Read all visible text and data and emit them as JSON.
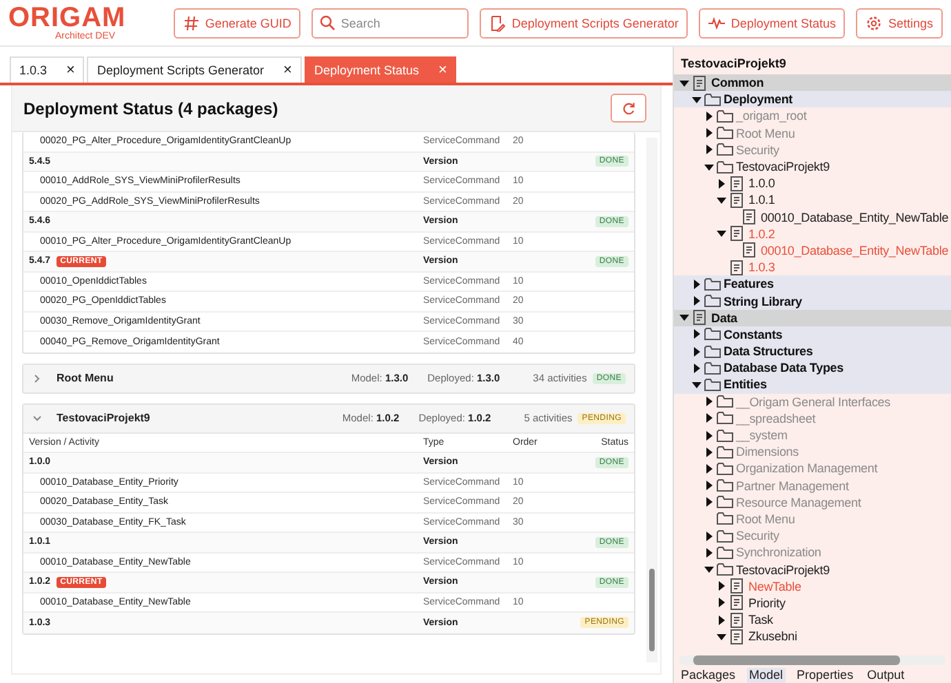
{
  "header": {
    "logo": {
      "title": "ORIGAM",
      "subtitle": "Architect DEV"
    },
    "actions": [
      {
        "kind": "button",
        "label": "Generate GUID"
      },
      {
        "kind": "search",
        "placeholder": "Search"
      },
      {
        "kind": "button",
        "label": "Deployment Scripts Generator"
      },
      {
        "kind": "button",
        "label": "Deployment Status"
      },
      {
        "kind": "button",
        "label": "Settings"
      }
    ]
  },
  "tabs": [
    {
      "label": "1.0.3",
      "close": "×",
      "selected": false
    },
    {
      "label": "Deployment Scripts Generator",
      "close": "×",
      "selected": false
    },
    {
      "label": "Deployment Status",
      "close": "×",
      "selected": true
    }
  ],
  "panel": {
    "title": "Deployment Status (4 packages)",
    "packages": [
      {
        "kind": "partial",
        "rows": [
          {
            "kind": "activity",
            "name": "00020_PG_Alter_Procedure_OrigamIdentityGrantCleanUp",
            "type": "ServiceCommand",
            "order": "20"
          },
          {
            "kind": "version",
            "name": "5.4.5",
            "type": "Version",
            "status": {
              "text": "DONE",
              "kind": "done"
            }
          },
          {
            "kind": "activity",
            "name": "00010_AddRole_SYS_ViewMiniProfilerResults",
            "type": "ServiceCommand",
            "order": "10"
          },
          {
            "kind": "activity",
            "name": "00020_PG_AddRole_SYS_ViewMiniProfilerResults",
            "type": "ServiceCommand",
            "order": "20"
          },
          {
            "kind": "version",
            "name": "5.4.6",
            "type": "Version",
            "status": {
              "text": "DONE",
              "kind": "done"
            }
          },
          {
            "kind": "activity",
            "name": "00010_PG_Alter_Procedure_OrigamIdentityGrantCleanUp",
            "type": "ServiceCommand",
            "order": "10"
          },
          {
            "kind": "version",
            "name": "5.4.7",
            "tag": "CURRENT",
            "type": "Version",
            "status": {
              "text": "DONE",
              "kind": "done"
            }
          },
          {
            "kind": "activity",
            "name": "00010_OpenIddictTables",
            "type": "ServiceCommand",
            "order": "10"
          },
          {
            "kind": "activity",
            "name": "00020_PG_OpenIddictTables",
            "type": "ServiceCommand",
            "order": "20"
          },
          {
            "kind": "activity",
            "name": "00030_Remove_OrigamIdentityGrant",
            "type": "ServiceCommand",
            "order": "30"
          },
          {
            "kind": "activity",
            "name": "00040_PG_Remove_OrigamIdentityGrant",
            "type": "ServiceCommand",
            "order": "40"
          }
        ]
      },
      {
        "kind": "package",
        "name": "Root Menu",
        "expanded": false,
        "model": "Model: **1.3.0**",
        "deployed": "Deployed: **1.3.0**",
        "activities": "34 activities",
        "status": {
          "text": "DONE",
          "kind": "done"
        }
      },
      {
        "kind": "package",
        "name": "TestovaciProjekt9",
        "expanded": true,
        "model": "Model: **1.0.2**",
        "deployed": "Deployed: **1.0.2**",
        "activities": "5 activities",
        "status": {
          "text": "PENDING",
          "kind": "pending"
        },
        "columns": [
          "Version / Activity",
          "Type",
          "Order",
          "Status"
        ],
        "rows": [
          {
            "kind": "version",
            "name": "1.0.0",
            "type": "Version",
            "status": {
              "text": "DONE",
              "kind": "done"
            }
          },
          {
            "kind": "activity",
            "name": "00010_Database_Entity_Priority",
            "type": "ServiceCommand",
            "order": "10"
          },
          {
            "kind": "activity",
            "name": "00020_Database_Entity_Task",
            "type": "ServiceCommand",
            "order": "20"
          },
          {
            "kind": "activity",
            "name": "00030_Database_Entity_FK_Task",
            "type": "ServiceCommand",
            "order": "30"
          },
          {
            "kind": "version",
            "name": "1.0.1",
            "type": "Version",
            "status": {
              "text": "DONE",
              "kind": "done"
            }
          },
          {
            "kind": "activity",
            "name": "00010_Database_Entity_NewTable",
            "type": "ServiceCommand",
            "order": "10"
          },
          {
            "kind": "version",
            "name": "1.0.2",
            "tag": "CURRENT",
            "type": "Version",
            "status": {
              "text": "DONE",
              "kind": "done"
            }
          },
          {
            "kind": "activity",
            "name": "00010_Database_Entity_NewTable",
            "type": "ServiceCommand",
            "order": "10"
          },
          {
            "kind": "version",
            "name": "1.0.3",
            "type": "Version",
            "status": {
              "text": "PENDING",
              "kind": "pending"
            }
          }
        ]
      }
    ]
  },
  "sidebar": {
    "title": "TestovaciProjekt9",
    "tree": [
      {
        "label": "Common",
        "kind": "document",
        "bold": true,
        "greyed": false,
        "modified": false,
        "expanded": true,
        "children": [
          {
            "label": "Deployment",
            "kind": "folder",
            "bold": true,
            "greyed": false,
            "modified": false,
            "expanded": true,
            "children": [
              {
                "label": "_origam_root",
                "kind": "folder",
                "bold": false,
                "greyed": true,
                "modified": false,
                "expanded": false
              },
              {
                "label": "Root Menu",
                "kind": "folder",
                "bold": false,
                "greyed": true,
                "modified": false,
                "expanded": false
              },
              {
                "label": "Security",
                "kind": "folder",
                "bold": false,
                "greyed": true,
                "modified": false,
                "expanded": false
              },
              {
                "label": "TestovaciProjekt9",
                "kind": "folder",
                "bold": false,
                "greyed": false,
                "modified": false,
                "expanded": true,
                "children": [
                  {
                    "label": "1.0.0",
                    "kind": "document",
                    "bold": false,
                    "greyed": false,
                    "modified": false,
                    "expanded": false
                  },
                  {
                    "label": "1.0.1",
                    "kind": "document",
                    "bold": false,
                    "greyed": false,
                    "modified": false,
                    "expanded": true,
                    "children": [
                      {
                        "label": "00010_Database_Entity_NewTable",
                        "kind": "document",
                        "bold": false,
                        "greyed": false,
                        "modified": false
                      }
                    ]
                  },
                  {
                    "label": "1.0.2",
                    "kind": "document",
                    "bold": false,
                    "greyed": false,
                    "modified": true,
                    "expanded": true,
                    "children": [
                      {
                        "label": "00010_Database_Entity_NewTable",
                        "kind": "document",
                        "bold": false,
                        "greyed": false,
                        "modified": true
                      }
                    ]
                  },
                  {
                    "label": "1.0.3",
                    "kind": "document",
                    "bold": false,
                    "greyed": false,
                    "modified": true
                  }
                ]
              }
            ]
          },
          {
            "label": "Features",
            "kind": "folder",
            "bold": true,
            "greyed": false,
            "modified": false,
            "expanded": false
          },
          {
            "label": "String Library",
            "kind": "folder",
            "bold": true,
            "greyed": false,
            "modified": false,
            "expanded": false
          }
        ]
      },
      {
        "label": "Data",
        "kind": "document",
        "bold": true,
        "greyed": false,
        "modified": false,
        "expanded": true,
        "children": [
          {
            "label": "Constants",
            "kind": "folder",
            "bold": true,
            "greyed": false,
            "modified": false,
            "expanded": false
          },
          {
            "label": "Data Structures",
            "kind": "folder",
            "bold": true,
            "greyed": false,
            "modified": false,
            "expanded": false
          },
          {
            "label": "Database Data Types",
            "kind": "folder",
            "bold": true,
            "greyed": false,
            "modified": false,
            "expanded": false
          },
          {
            "label": "Entities",
            "kind": "folder",
            "bold": true,
            "greyed": false,
            "modified": false,
            "expanded": true,
            "children": [
              {
                "label": "__Origam General Interfaces",
                "kind": "folder",
                "bold": false,
                "greyed": true,
                "modified": false,
                "expanded": false
              },
              {
                "label": "__spreadsheet",
                "kind": "folder",
                "bold": false,
                "greyed": true,
                "modified": false,
                "expanded": false
              },
              {
                "label": "__system",
                "kind": "folder",
                "bold": false,
                "greyed": true,
                "modified": false,
                "expanded": false
              },
              {
                "label": "Dimensions",
                "kind": "folder",
                "bold": false,
                "greyed": true,
                "modified": false,
                "expanded": false
              },
              {
                "label": "Organization Management",
                "kind": "folder",
                "bold": false,
                "greyed": true,
                "modified": false,
                "expanded": false
              },
              {
                "label": "Partner Management",
                "kind": "folder",
                "bold": false,
                "greyed": true,
                "modified": false,
                "expanded": false
              },
              {
                "label": "Resource Management",
                "kind": "folder",
                "bold": false,
                "greyed": true,
                "modified": false,
                "expanded": false
              },
              {
                "label": "Root Menu",
                "kind": "folder",
                "bold": false,
                "greyed": true,
                "modified": false
              },
              {
                "label": "Security",
                "kind": "folder",
                "bold": false,
                "greyed": true,
                "modified": false,
                "expanded": false
              },
              {
                "label": "Synchronization",
                "kind": "folder",
                "bold": false,
                "greyed": true,
                "modified": false,
                "expanded": false
              },
              {
                "label": "TestovaciProjekt9",
                "kind": "folder",
                "bold": false,
                "greyed": false,
                "modified": false,
                "expanded": true,
                "children": [
                  {
                    "label": "NewTable",
                    "kind": "document",
                    "bold": false,
                    "greyed": false,
                    "modified": true,
                    "expanded": false
                  },
                  {
                    "label": "Priority",
                    "kind": "document",
                    "bold": false,
                    "greyed": false,
                    "modified": false,
                    "expanded": false
                  },
                  {
                    "label": "Task",
                    "kind": "document",
                    "bold": false,
                    "greyed": false,
                    "modified": false,
                    "expanded": false
                  },
                  {
                    "label": "Zkusebni",
                    "kind": "document",
                    "bold": false,
                    "greyed": false,
                    "modified": false,
                    "expanded": true
                  }
                ]
              }
            ]
          }
        ]
      }
    ],
    "bottom_tabs": [
      {
        "label": "Packages",
        "selected": false
      },
      {
        "label": "Model",
        "selected": true
      },
      {
        "label": "Properties",
        "selected": false
      },
      {
        "label": "Output",
        "selected": false
      }
    ]
  }
}
